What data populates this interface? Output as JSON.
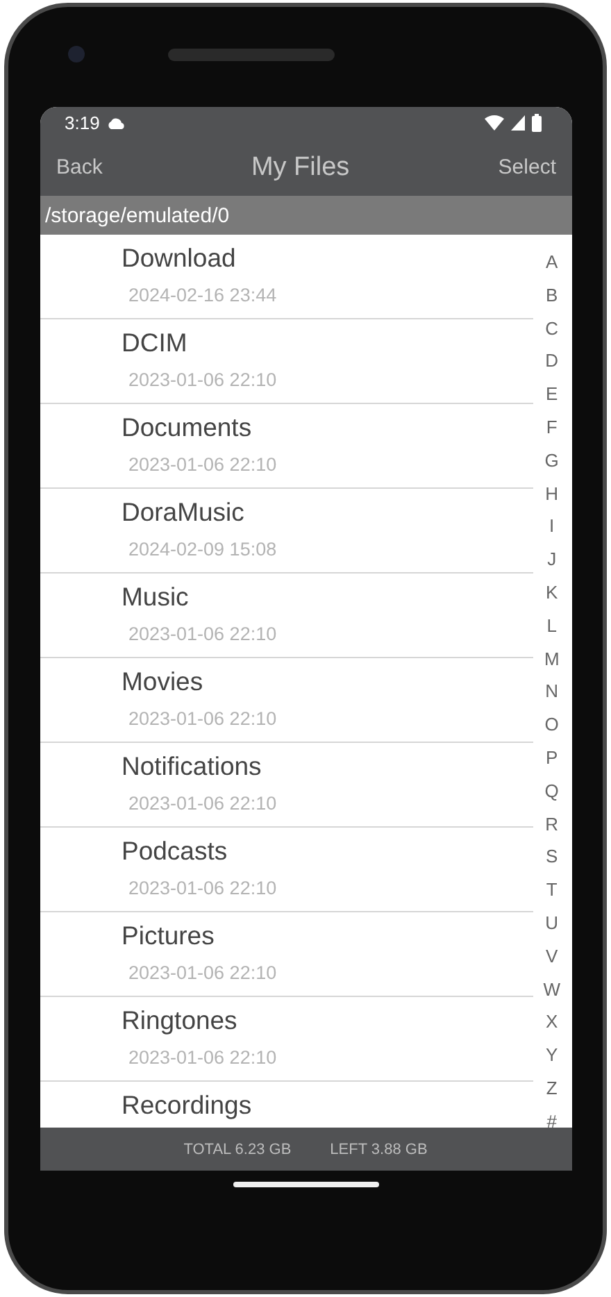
{
  "status_bar": {
    "time": "3:19"
  },
  "header": {
    "back": "Back",
    "title": "My Files",
    "action": "Select"
  },
  "path": "/storage/emulated/0",
  "files": [
    {
      "name": "Download",
      "date": "2024-02-16 23:44"
    },
    {
      "name": "DCIM",
      "date": "2023-01-06 22:10"
    },
    {
      "name": "Documents",
      "date": "2023-01-06 22:10"
    },
    {
      "name": "DoraMusic",
      "date": "2024-02-09 15:08"
    },
    {
      "name": "Music",
      "date": "2023-01-06 22:10"
    },
    {
      "name": "Movies",
      "date": "2023-01-06 22:10"
    },
    {
      "name": "Notifications",
      "date": "2023-01-06 22:10"
    },
    {
      "name": "Podcasts",
      "date": "2023-01-06 22:10"
    },
    {
      "name": "Pictures",
      "date": "2023-01-06 22:10"
    },
    {
      "name": "Ringtones",
      "date": "2023-01-06 22:10"
    },
    {
      "name": "Recordings"
    }
  ],
  "index": [
    "A",
    "B",
    "C",
    "D",
    "E",
    "F",
    "G",
    "H",
    "I",
    "J",
    "K",
    "L",
    "M",
    "N",
    "O",
    "P",
    "Q",
    "R",
    "S",
    "T",
    "U",
    "V",
    "W",
    "X",
    "Y",
    "Z",
    "#"
  ],
  "footer": {
    "total": "TOTAL 6.23 GB",
    "left": "LEFT 3.88 GB"
  }
}
